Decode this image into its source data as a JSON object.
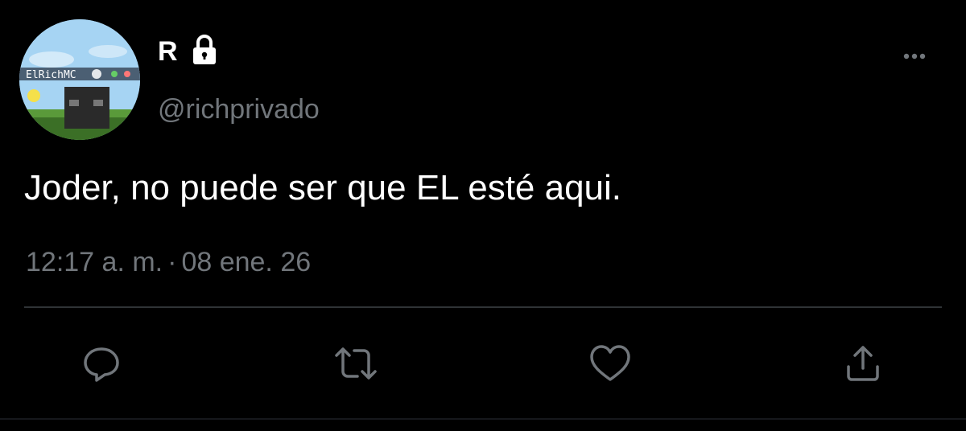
{
  "tweet": {
    "avatar_label": "ElRichMC",
    "display_name": "R",
    "handle": "@richprivado",
    "text": "Joder, no puede ser que EL esté aqui.",
    "time": "12:17 a. m.",
    "separator": "·",
    "date": "08 ene. 26"
  },
  "icons": {
    "lock": "lock-icon",
    "more": "more-horizontal-icon",
    "reply": "reply-icon",
    "retweet": "retweet-icon",
    "like": "like-icon",
    "share": "share-icon"
  },
  "colors": {
    "background": "#000000",
    "primary_text": "#ffffff",
    "secondary_text": "#71767b",
    "divider": "#2f3336"
  }
}
